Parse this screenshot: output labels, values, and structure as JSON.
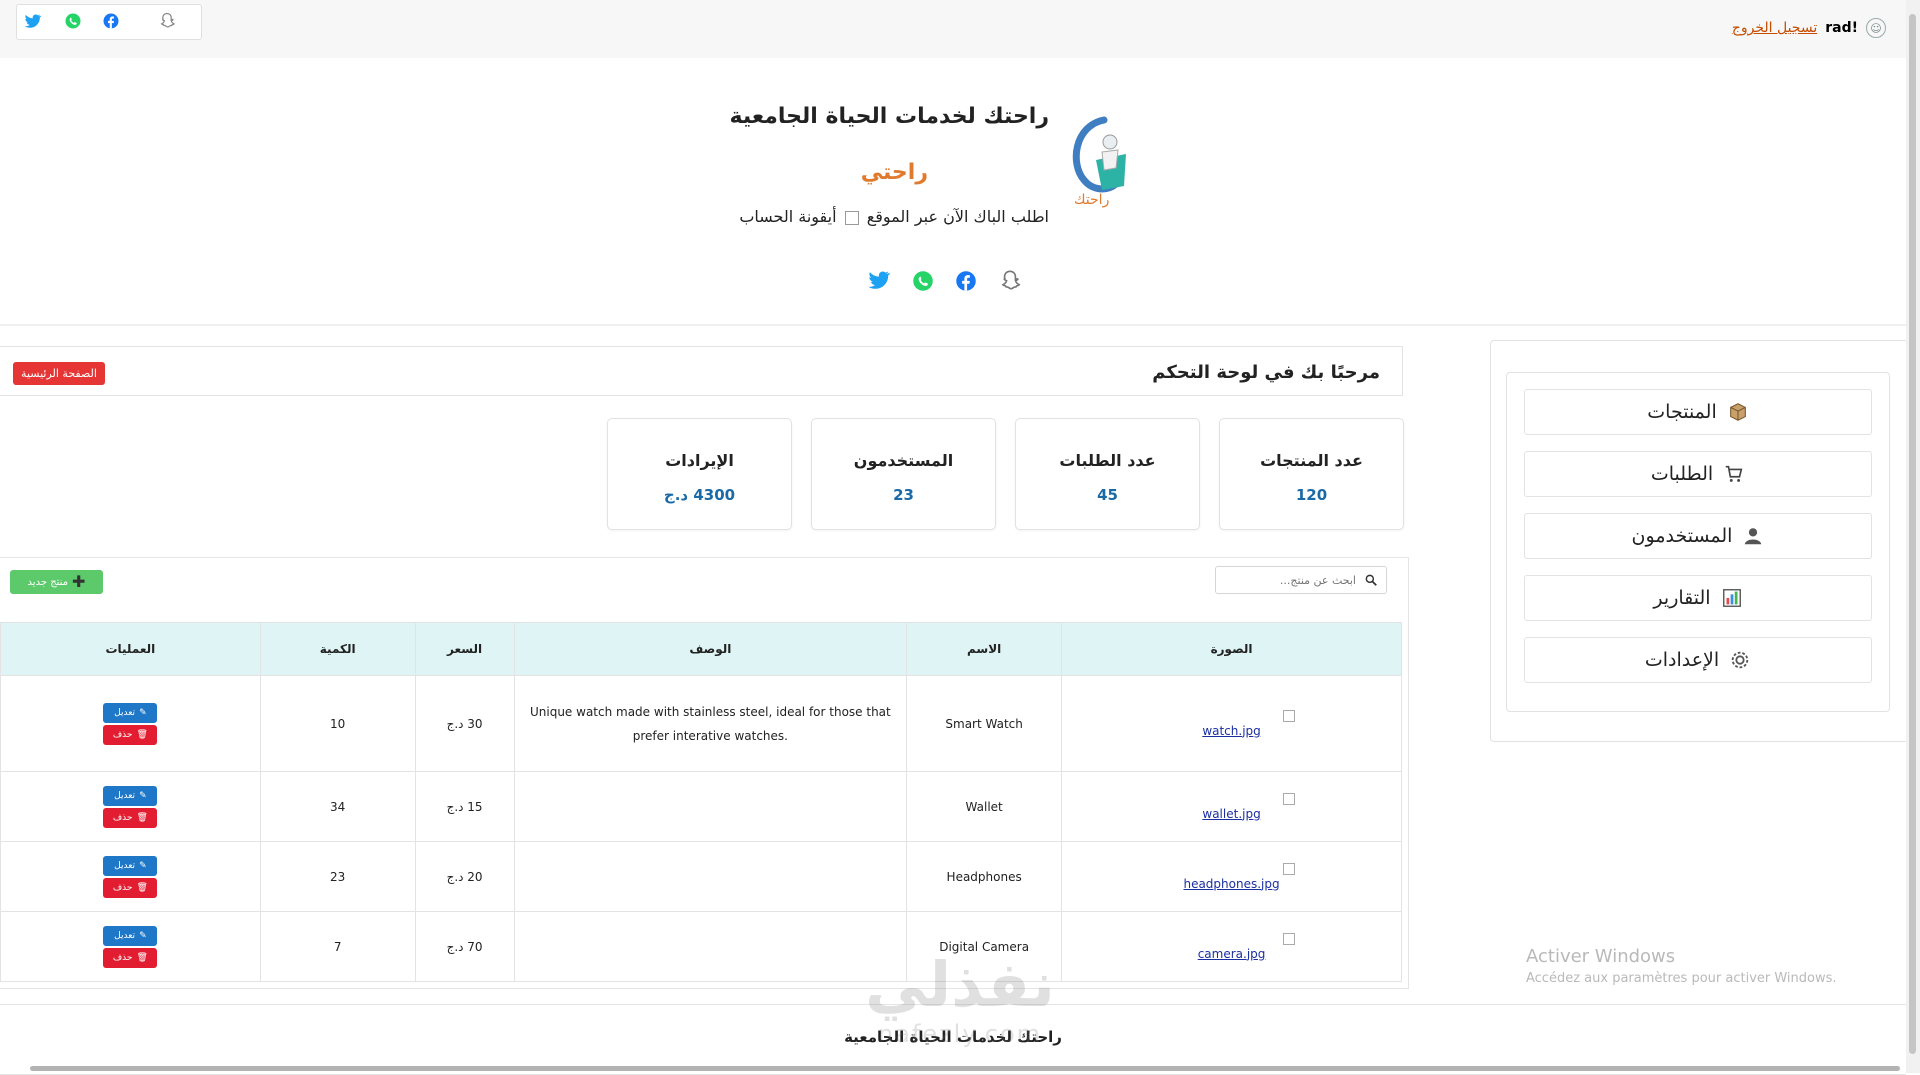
{
  "topbar": {
    "logout_label": "تسجيل الخروج",
    "username": "!rad",
    "social_icons": [
      "twitter-icon",
      "whatsapp-icon",
      "facebook-icon",
      "snapchat-icon"
    ]
  },
  "header": {
    "title": "راحتك لخدمات الحياة الجامعية",
    "brand": "راحتي",
    "cta_text": "اطلب الباك الآن عبر الموقع",
    "cta_icon_alt": "أيقونة الحساب",
    "logo_text": "راحتك"
  },
  "sidebar": {
    "items": [
      {
        "label": "المنتجات",
        "icon": "box-icon"
      },
      {
        "label": "الطلبات",
        "icon": "cart-icon"
      },
      {
        "label": "المستخدمون",
        "icon": "user-icon"
      },
      {
        "label": "التقارير",
        "icon": "chart-icon"
      },
      {
        "label": "الإعدادات",
        "icon": "gear-icon"
      }
    ]
  },
  "dashboard": {
    "welcome": "مرحبًا بك في لوحة التحكم",
    "home_button": "الصفحة الرئيسية",
    "stats": [
      {
        "label": "عدد المنتجات",
        "value": "120"
      },
      {
        "label": "عدد الطلبات",
        "value": "45"
      },
      {
        "label": "المستخدمون",
        "value": "23"
      },
      {
        "label": "الإيرادات",
        "value": "4300 د.ج"
      }
    ]
  },
  "products": {
    "search_placeholder": "ابحث عن منتج...",
    "add_button": "منتج جديد",
    "columns": [
      "الصورة",
      "الاسم",
      "الوصف",
      "السعر",
      "الكمية",
      "العمليات"
    ],
    "edit_label": "تعديل",
    "delete_label": "حذف",
    "rows": [
      {
        "image": "watch.jpg",
        "name": "Smart Watch",
        "description": "Unique watch made with stainless steel, ideal for those that prefer interative watches.",
        "price": "30 د.ج",
        "quantity": "10"
      },
      {
        "image": "wallet.jpg",
        "name": "Wallet",
        "description": "",
        "price": "15 د.ج",
        "quantity": "34"
      },
      {
        "image": "headphones.jpg",
        "name": "Headphones",
        "description": "",
        "price": "20 د.ج",
        "quantity": "23"
      },
      {
        "image": "camera.jpg",
        "name": "Digital Camera",
        "description": "",
        "price": "70 د.ج",
        "quantity": "7"
      }
    ]
  },
  "footer": {
    "text": "راحتك لخدمات الحياة الجامعية"
  },
  "overlay": {
    "watermark_ar": "نفذلي",
    "watermark_en": "nafezly.com",
    "activate_title": "Activer Windows",
    "activate_sub": "Accédez aux paramètres pour activer Windows."
  },
  "colors": {
    "accent_orange": "#e07a2e",
    "danger": "#e53535",
    "success": "#5cc96b",
    "primary": "#1f77c8",
    "stat_value": "#1a6aa8",
    "table_header": "#dff4f4"
  }
}
